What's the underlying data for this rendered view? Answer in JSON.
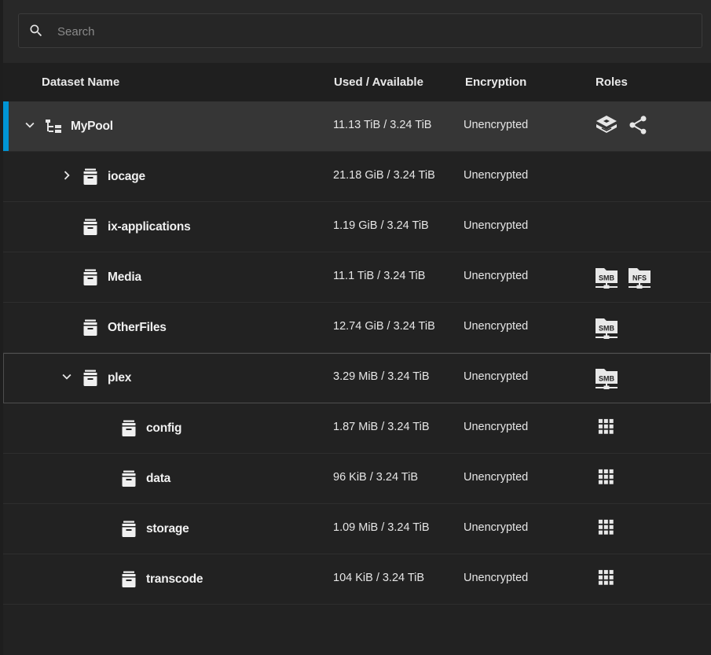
{
  "search": {
    "placeholder": "Search",
    "value": ""
  },
  "columns": {
    "name": "Dataset Name",
    "used": "Used / Available",
    "encryption": "Encryption",
    "roles": "Roles"
  },
  "rows": [
    {
      "name": "MyPool",
      "used": "11.13 TiB / 3.24 TiB",
      "encryption": "Unencrypted",
      "roles": [
        "dataset-sharing-icon",
        "share-icon"
      ],
      "expand": "expanded",
      "icon": "pool-tree-icon",
      "depth": 0
    },
    {
      "name": "iocage",
      "used": "21.18 GiB / 3.24 TiB",
      "encryption": "Unencrypted",
      "roles": [],
      "expand": "collapsed",
      "icon": "dataset-icon",
      "depth": 1
    },
    {
      "name": "ix-applications",
      "used": "1.19 GiB / 3.24 TiB",
      "encryption": "Unencrypted",
      "roles": [],
      "expand": "none",
      "icon": "dataset-icon",
      "depth": 1
    },
    {
      "name": "Media",
      "used": "11.1 TiB / 3.24 TiB",
      "encryption": "Unencrypted",
      "roles": [
        "smb-share-icon",
        "nfs-share-icon"
      ],
      "expand": "none",
      "icon": "dataset-icon",
      "depth": 1
    },
    {
      "name": "OtherFiles",
      "used": "12.74 GiB / 3.24 TiB",
      "encryption": "Unencrypted",
      "roles": [
        "smb-share-icon"
      ],
      "expand": "none",
      "icon": "dataset-icon",
      "depth": 1
    },
    {
      "name": "plex",
      "used": "3.29 MiB / 3.24 TiB",
      "encryption": "Unencrypted",
      "roles": [
        "smb-share-icon"
      ],
      "expand": "expanded",
      "icon": "dataset-icon",
      "depth": 1
    },
    {
      "name": "config",
      "used": "1.87 MiB / 3.24 TiB",
      "encryption": "Unencrypted",
      "roles": [
        "apps-grid-icon"
      ],
      "expand": "none",
      "icon": "dataset-icon",
      "depth": 2
    },
    {
      "name": "data",
      "used": "96 KiB / 3.24 TiB",
      "encryption": "Unencrypted",
      "roles": [
        "apps-grid-icon"
      ],
      "expand": "none",
      "icon": "dataset-icon",
      "depth": 2
    },
    {
      "name": "storage",
      "used": "1.09 MiB / 3.24 TiB",
      "encryption": "Unencrypted",
      "roles": [
        "apps-grid-icon"
      ],
      "expand": "none",
      "icon": "dataset-icon",
      "depth": 2
    },
    {
      "name": "transcode",
      "used": "104 KiB / 3.24 TiB",
      "encryption": "Unencrypted",
      "roles": [
        "apps-grid-icon"
      ],
      "expand": "none",
      "icon": "dataset-icon",
      "depth": 2
    }
  ],
  "role_labels": {
    "smb": "SMB",
    "nfs": "NFS"
  },
  "selected_row": "MyPool",
  "focused_row": "plex",
  "colors": {
    "accent": "#0095d5",
    "background": "#1e1e1e",
    "row_selected": "#363636"
  }
}
